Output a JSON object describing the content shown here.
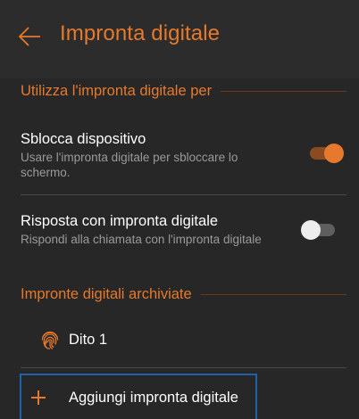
{
  "appbar": {
    "title": "Impronta digitale",
    "back_icon": "arrow-left-icon"
  },
  "colors": {
    "accent": "#e6792b",
    "background": "#272727",
    "focus_border": "#1e62a8"
  },
  "sections": [
    {
      "header": "Utilizza l'impronta digitale per",
      "settings": [
        {
          "title": "Sblocca dispositivo",
          "summary": "Usare l'impronta digitale per sbloccare lo schermo.",
          "enabled": true
        },
        {
          "title": "Risposta con impronta digitale",
          "summary": "Rispondi alla chiamata con l'impronta digitale",
          "enabled": false
        }
      ]
    },
    {
      "header": "Impronte digitali archiviate",
      "items": [
        {
          "label": "Dito 1",
          "icon": "fingerprint-icon"
        }
      ],
      "add_label": "Aggiungi impronta digitale",
      "add_icon": "plus-icon"
    }
  ]
}
